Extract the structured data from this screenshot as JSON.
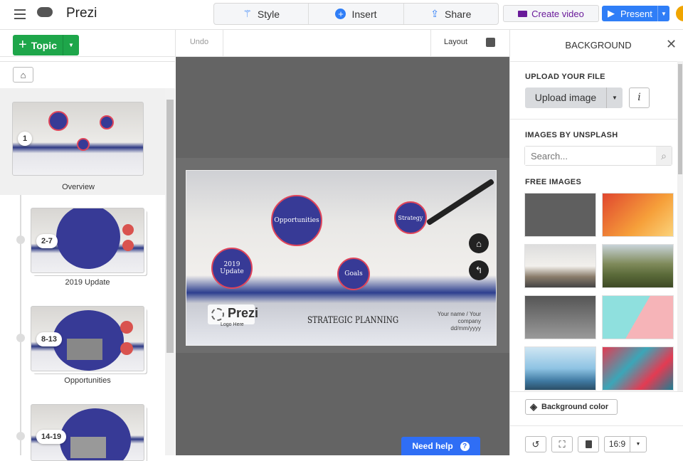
{
  "app": {
    "title": "Prezi"
  },
  "topbar": {
    "tabs": [
      {
        "label": "Style",
        "icon": "magic-wand-icon"
      },
      {
        "label": "Insert",
        "icon": "plus-circle-icon"
      },
      {
        "label": "Share",
        "icon": "upload-icon"
      }
    ],
    "create_video": "Create video",
    "present": "Present"
  },
  "toolbar": {
    "topic": "Topic",
    "undo": "Undo",
    "layout": "Layout"
  },
  "sidebar": {
    "items": [
      {
        "badge": "1",
        "label": "Overview"
      },
      {
        "badge": "2-7",
        "label": "2019 Update"
      },
      {
        "badge": "8-13",
        "label": "Opportunities"
      },
      {
        "badge": "14-19",
        "label": ""
      }
    ]
  },
  "slide": {
    "circles": [
      "2019 Update",
      "Opportunities",
      "Goals",
      "Strategy"
    ],
    "title": "STRATEGIC PLANNING",
    "logo": "Prezi",
    "logo_sub": "Logo Here",
    "author": "Your name / Your company",
    "date": "dd/mm/yyyy"
  },
  "help": {
    "label": "Need help",
    "icon": "?"
  },
  "panel": {
    "title": "BACKGROUND",
    "upload_heading": "UPLOAD YOUR FILE",
    "upload_button": "Upload image",
    "info": "i",
    "unsplash_heading": "IMAGES BY UNSPLASH",
    "search_placeholder": "Search...",
    "free_heading": "FREE IMAGES",
    "background_color": "Background color",
    "aspect": "16:9"
  },
  "colors": {
    "accent": "#2f7ef7",
    "topic_green": "#1ea64a",
    "video_purple": "#6a1b9a",
    "slide_circle": "#373a96"
  }
}
